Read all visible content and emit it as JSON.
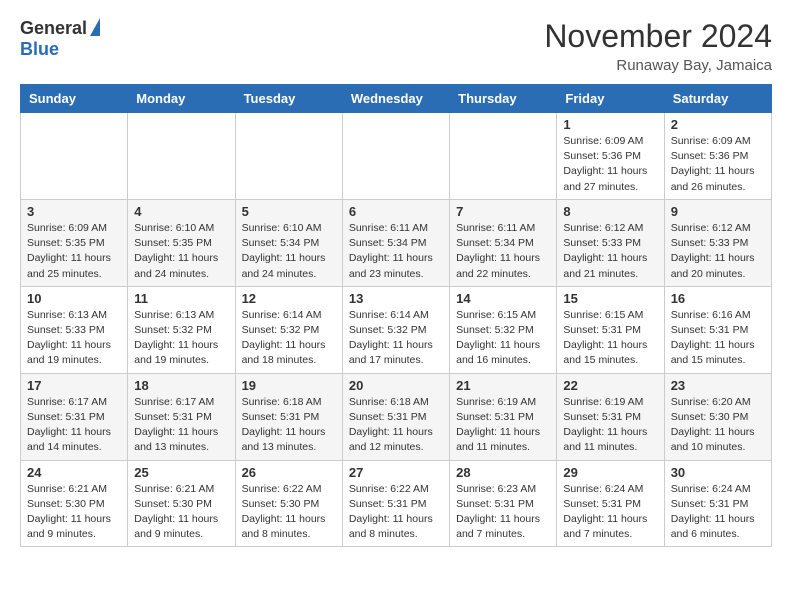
{
  "header": {
    "logo_general": "General",
    "logo_blue": "Blue",
    "month_title": "November 2024",
    "subtitle": "Runaway Bay, Jamaica"
  },
  "weekdays": [
    "Sunday",
    "Monday",
    "Tuesday",
    "Wednesday",
    "Thursday",
    "Friday",
    "Saturday"
  ],
  "weeks": [
    [
      {
        "day": "",
        "info": ""
      },
      {
        "day": "",
        "info": ""
      },
      {
        "day": "",
        "info": ""
      },
      {
        "day": "",
        "info": ""
      },
      {
        "day": "",
        "info": ""
      },
      {
        "day": "1",
        "info": "Sunrise: 6:09 AM\nSunset: 5:36 PM\nDaylight: 11 hours\nand 27 minutes."
      },
      {
        "day": "2",
        "info": "Sunrise: 6:09 AM\nSunset: 5:36 PM\nDaylight: 11 hours\nand 26 minutes."
      }
    ],
    [
      {
        "day": "3",
        "info": "Sunrise: 6:09 AM\nSunset: 5:35 PM\nDaylight: 11 hours\nand 25 minutes."
      },
      {
        "day": "4",
        "info": "Sunrise: 6:10 AM\nSunset: 5:35 PM\nDaylight: 11 hours\nand 24 minutes."
      },
      {
        "day": "5",
        "info": "Sunrise: 6:10 AM\nSunset: 5:34 PM\nDaylight: 11 hours\nand 24 minutes."
      },
      {
        "day": "6",
        "info": "Sunrise: 6:11 AM\nSunset: 5:34 PM\nDaylight: 11 hours\nand 23 minutes."
      },
      {
        "day": "7",
        "info": "Sunrise: 6:11 AM\nSunset: 5:34 PM\nDaylight: 11 hours\nand 22 minutes."
      },
      {
        "day": "8",
        "info": "Sunrise: 6:12 AM\nSunset: 5:33 PM\nDaylight: 11 hours\nand 21 minutes."
      },
      {
        "day": "9",
        "info": "Sunrise: 6:12 AM\nSunset: 5:33 PM\nDaylight: 11 hours\nand 20 minutes."
      }
    ],
    [
      {
        "day": "10",
        "info": "Sunrise: 6:13 AM\nSunset: 5:33 PM\nDaylight: 11 hours\nand 19 minutes."
      },
      {
        "day": "11",
        "info": "Sunrise: 6:13 AM\nSunset: 5:32 PM\nDaylight: 11 hours\nand 19 minutes."
      },
      {
        "day": "12",
        "info": "Sunrise: 6:14 AM\nSunset: 5:32 PM\nDaylight: 11 hours\nand 18 minutes."
      },
      {
        "day": "13",
        "info": "Sunrise: 6:14 AM\nSunset: 5:32 PM\nDaylight: 11 hours\nand 17 minutes."
      },
      {
        "day": "14",
        "info": "Sunrise: 6:15 AM\nSunset: 5:32 PM\nDaylight: 11 hours\nand 16 minutes."
      },
      {
        "day": "15",
        "info": "Sunrise: 6:15 AM\nSunset: 5:31 PM\nDaylight: 11 hours\nand 15 minutes."
      },
      {
        "day": "16",
        "info": "Sunrise: 6:16 AM\nSunset: 5:31 PM\nDaylight: 11 hours\nand 15 minutes."
      }
    ],
    [
      {
        "day": "17",
        "info": "Sunrise: 6:17 AM\nSunset: 5:31 PM\nDaylight: 11 hours\nand 14 minutes."
      },
      {
        "day": "18",
        "info": "Sunrise: 6:17 AM\nSunset: 5:31 PM\nDaylight: 11 hours\nand 13 minutes."
      },
      {
        "day": "19",
        "info": "Sunrise: 6:18 AM\nSunset: 5:31 PM\nDaylight: 11 hours\nand 13 minutes."
      },
      {
        "day": "20",
        "info": "Sunrise: 6:18 AM\nSunset: 5:31 PM\nDaylight: 11 hours\nand 12 minutes."
      },
      {
        "day": "21",
        "info": "Sunrise: 6:19 AM\nSunset: 5:31 PM\nDaylight: 11 hours\nand 11 minutes."
      },
      {
        "day": "22",
        "info": "Sunrise: 6:19 AM\nSunset: 5:31 PM\nDaylight: 11 hours\nand 11 minutes."
      },
      {
        "day": "23",
        "info": "Sunrise: 6:20 AM\nSunset: 5:30 PM\nDaylight: 11 hours\nand 10 minutes."
      }
    ],
    [
      {
        "day": "24",
        "info": "Sunrise: 6:21 AM\nSunset: 5:30 PM\nDaylight: 11 hours\nand 9 minutes."
      },
      {
        "day": "25",
        "info": "Sunrise: 6:21 AM\nSunset: 5:30 PM\nDaylight: 11 hours\nand 9 minutes."
      },
      {
        "day": "26",
        "info": "Sunrise: 6:22 AM\nSunset: 5:30 PM\nDaylight: 11 hours\nand 8 minutes."
      },
      {
        "day": "27",
        "info": "Sunrise: 6:22 AM\nSunset: 5:31 PM\nDaylight: 11 hours\nand 8 minutes."
      },
      {
        "day": "28",
        "info": "Sunrise: 6:23 AM\nSunset: 5:31 PM\nDaylight: 11 hours\nand 7 minutes."
      },
      {
        "day": "29",
        "info": "Sunrise: 6:24 AM\nSunset: 5:31 PM\nDaylight: 11 hours\nand 7 minutes."
      },
      {
        "day": "30",
        "info": "Sunrise: 6:24 AM\nSunset: 5:31 PM\nDaylight: 11 hours\nand 6 minutes."
      }
    ]
  ]
}
